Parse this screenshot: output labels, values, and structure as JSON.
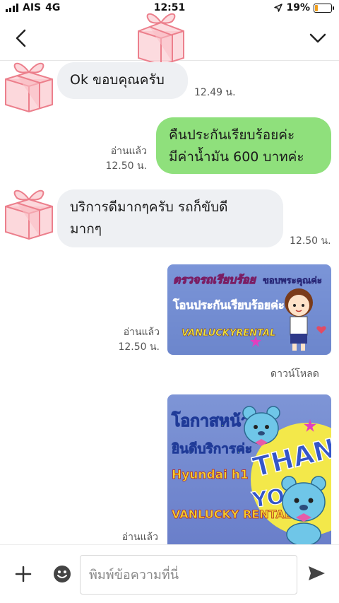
{
  "status_bar": {
    "carrier": "AIS",
    "network": "4G",
    "time": "12:51",
    "battery": "19%",
    "battery_level": 0.19
  },
  "header": {
    "back_icon": "chevron-left-icon",
    "menu_icon": "chevron-down-icon"
  },
  "messages": [
    {
      "direction": "in",
      "text": "Ok ขอบคุณครับ",
      "time": "12.49 น."
    },
    {
      "direction": "out",
      "text_line1": "คืนประกันเรียบร้อยค่ะ",
      "text_line2": "มีค่าน้ำมัน 600 บาทค่ะ",
      "read": "อ่านแล้ว",
      "time": "12.50 น."
    },
    {
      "direction": "in",
      "text_line1": "บริการดีมากๆครับ รถก็ขับดี",
      "text_line2": "มากๆ",
      "time": "12.50 น."
    },
    {
      "direction": "out",
      "type": "image",
      "read": "อ่านแล้ว",
      "time": "12.50 น.",
      "download": "ดาวน์โหลด"
    },
    {
      "direction": "out",
      "type": "image",
      "read": "อ่านแล้ว"
    }
  ],
  "sticker1": {
    "line1": "ตรวจรถเรียบร้อย",
    "thanks": "ขอบพระคุณค่ะ",
    "line2": "โอนประกันเรียบร้อยค่ะ",
    "brand": "VANLUCKYRENTAL"
  },
  "sticker2": {
    "line1": "โอกาสหน้า",
    "line2": "ยินดีบริการค่ะ",
    "line3": "Hyundai h1",
    "line4": "VANLUCKY RENTAL",
    "thank": "THANK",
    "you": "YOU"
  },
  "input_bar": {
    "placeholder": "พิมพ์ข้อความที่นี่",
    "plus_icon": "plus-icon",
    "emoji_icon": "emoji-icon",
    "send_icon": "send-icon"
  },
  "colors": {
    "outgoing_bubble": "#8fe07c",
    "incoming_bubble": "#eef0f3",
    "gift_pink": "#f2a0a8"
  }
}
